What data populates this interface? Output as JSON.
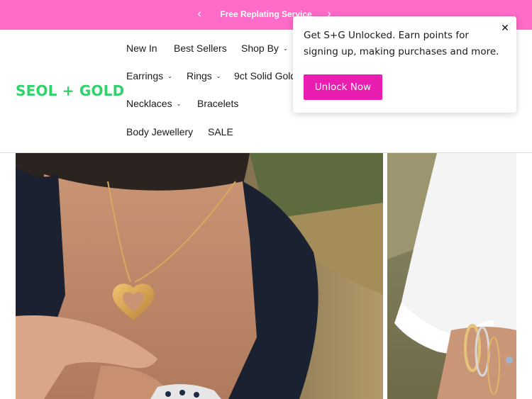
{
  "announcement": {
    "text": "Free Replating Service",
    "prev_icon": "chevron-left-icon",
    "next_icon": "chevron-right-icon"
  },
  "brand": {
    "logo_text": "SEOL + GOLD",
    "color": "#2fd36a"
  },
  "nav": {
    "new_in": "New In",
    "best_sellers": "Best Sellers",
    "shop_by": "Shop By",
    "earrings": "Earrings",
    "rings": "Rings",
    "solid_gold": "9ct Solid Gold",
    "necklaces": "Necklaces",
    "bracelets": "Bracelets",
    "body_jewellery": "Body Jewellery",
    "sale": "SALE",
    "dropdown_icon": "chevron-down-icon"
  },
  "popup": {
    "message": "Get S+G Unlocked. Earn points for signing up, making purchases and more.",
    "cta_label": "Unlock Now",
    "close_icon": "close-icon"
  },
  "colors": {
    "announcement_bg": "#ff6bc8",
    "cta_bg": "#e91eb0"
  }
}
